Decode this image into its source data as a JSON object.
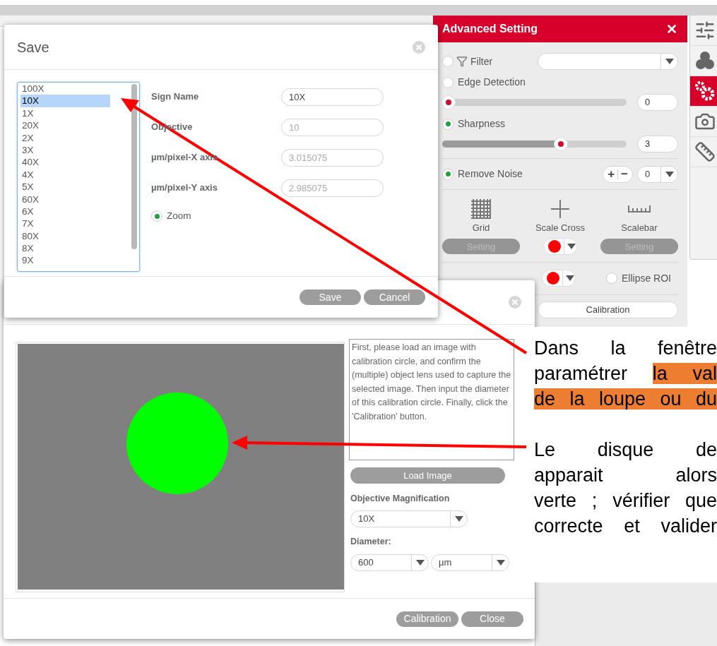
{
  "save_dialog": {
    "title": "Save",
    "magnifications": [
      {
        "label": "100X",
        "selected": false
      },
      {
        "label": "10X",
        "selected": true
      },
      {
        "label": "1X",
        "selected": false
      },
      {
        "label": "20X",
        "selected": false
      },
      {
        "label": "2X",
        "selected": false
      },
      {
        "label": "3X",
        "selected": false
      },
      {
        "label": "40X",
        "selected": false
      },
      {
        "label": "4X",
        "selected": false
      },
      {
        "label": "5X",
        "selected": false
      },
      {
        "label": "60X",
        "selected": false
      },
      {
        "label": "6X",
        "selected": false
      },
      {
        "label": "7X",
        "selected": false
      },
      {
        "label": "80X",
        "selected": false
      },
      {
        "label": "8X",
        "selected": false
      },
      {
        "label": "9X",
        "selected": false
      }
    ],
    "fields": [
      {
        "label": "Sign Name",
        "value": "10X",
        "disabled": false
      },
      {
        "label": "Objective",
        "value": "10",
        "disabled": true
      },
      {
        "label": "µm/pixel-X axis",
        "value": "3.015075",
        "disabled": true
      },
      {
        "label": "µm/pixel-Y axis",
        "value": "2.985075",
        "disabled": true
      }
    ],
    "zoom": {
      "label": "Zoom",
      "checked": true
    },
    "buttons": [
      "Save",
      "Cancel"
    ]
  },
  "advanced_setting": {
    "title": "Advanced Setting",
    "filter": {
      "label": "Filter",
      "checked": false
    },
    "edge_detection": {
      "label": "Edge Detection",
      "checked": false,
      "level": 0,
      "value": "0"
    },
    "sharpness": {
      "label": "Sharpness",
      "checked": true,
      "level": 0.655,
      "value": "3"
    },
    "remove_noise": {
      "label": "Remove Noise",
      "checked": true,
      "plus": "+",
      "minus": "−",
      "value": "0"
    },
    "tools": [
      {
        "kind": "grid",
        "label": "Grid",
        "button": "Setting",
        "disabled": true
      },
      {
        "kind": "cross",
        "label": "Scale Cross",
        "color": "#ff0000"
      },
      {
        "kind": "scalebar",
        "label": "Scalebar",
        "button": "Setting",
        "disabled": true
      }
    ],
    "roi": {
      "color": "#ff0000",
      "ellipse": {
        "label": "Ellipse ROI",
        "checked": false
      }
    },
    "calibration_button": "Calibration"
  },
  "tool_rail": [
    {
      "kind": "sliders",
      "selected": false
    },
    {
      "kind": "colors",
      "selected": false
    },
    {
      "kind": "gears",
      "selected": true
    },
    {
      "kind": "camera",
      "selected": false
    },
    {
      "kind": "ruler",
      "selected": false
    }
  ],
  "calibration_dialog": {
    "instructions": "First, please load an image with calibration circle, and confirm the (multiple) object lens used to capture the selected image. Then input the diameter of this calibration circle. Finally, click the 'Calibration' button.",
    "load_button": "Load Image",
    "magnification_label": "Objective Magnification",
    "magnification": "10X",
    "diameter_label": "Diameter:",
    "diameter": "600",
    "unit": "µm",
    "buttons": [
      "Calibration",
      "Close"
    ]
  },
  "annotation": {
    "paragraphs": [
      [
        [
          {
            "text": "Dans la fenêtre",
            "highlight": false
          }
        ],
        [
          {
            "text": "paramétrer ",
            "highlight": false
          },
          {
            "text": "la val",
            "highlight": true
          }
        ],
        [
          {
            "text": "de la loupe ou du",
            "highlight": true
          }
        ]
      ],
      [
        [
          {
            "text": "Le disque de",
            "highlight": false
          }
        ],
        [
          {
            "text": "apparait alors",
            "highlight": false
          }
        ],
        [
          {
            "text": "verte ; vérifier que",
            "highlight": false
          }
        ],
        [
          {
            "text": "correcte et valider",
            "highlight": false
          }
        ]
      ]
    ]
  }
}
